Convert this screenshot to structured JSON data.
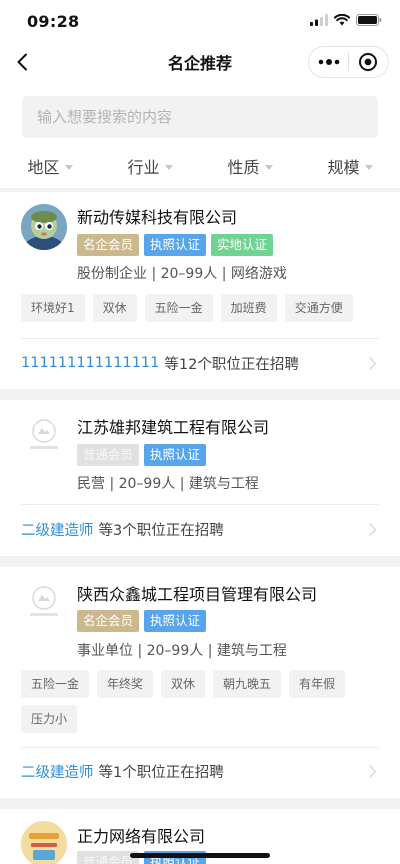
{
  "status_bar": {
    "time": "09:28"
  },
  "nav": {
    "title": "名企推荐"
  },
  "search": {
    "placeholder": "输入想要搜索的内容"
  },
  "filters": [
    {
      "label": "地区"
    },
    {
      "label": "行业"
    },
    {
      "label": "性质"
    },
    {
      "label": "规模"
    }
  ],
  "companies": [
    {
      "name": "新动传媒科技有限公司",
      "badges": [
        "名企会员",
        "执照认证",
        "实地认证"
      ],
      "meta": "股份制企业 | 20–99人 | 网络游戏",
      "tags": [
        "环境好1",
        "双休",
        "五险一金",
        "加班费",
        "交通方便"
      ],
      "job_link": "111111111111111",
      "job_text": "等12个职位正在招聘"
    },
    {
      "name": "江苏雄邦建筑工程有限公司",
      "badges": [
        "普通会员",
        "执照认证"
      ],
      "meta": "民营 | 20–99人 | 建筑与工程",
      "job_link": "二级建造师",
      "job_text": "等3个职位正在招聘"
    },
    {
      "name": "陕西众鑫城工程项目管理有限公司",
      "badges": [
        "名企会员",
        "执照认证"
      ],
      "meta": "事业单位 | 20–99人 | 建筑与工程",
      "tags": [
        "五险一金",
        "年终奖",
        "双休",
        "朝九晚五",
        "有年假",
        "压力小"
      ],
      "job_link": "二级建造师",
      "job_text": "等1个职位正在招聘"
    },
    {
      "name": "正力网络有限公司",
      "badges": [
        "普通会员",
        "执照认证"
      ]
    }
  ],
  "colors": {
    "badge_gold": "#cbb98d",
    "badge_blue": "#58a5ec",
    "badge_green": "#6fd48f",
    "job_link": "#2f8ed6"
  },
  "icons": [
    "back-arrow-icon",
    "more-dots-icon",
    "close-target-icon",
    "chevron-right-icon",
    "signal-icon",
    "wifi-icon",
    "battery-icon"
  ]
}
